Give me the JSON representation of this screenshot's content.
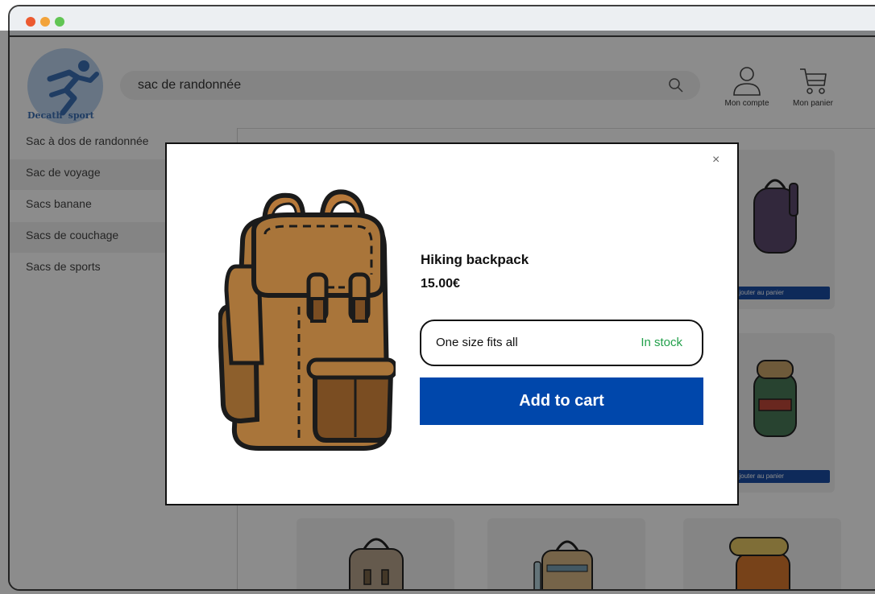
{
  "brand": {
    "name": "Decath' sport"
  },
  "search": {
    "value": "sac de randonnée"
  },
  "header": {
    "account_label": "Mon compte",
    "cart_label": "Mon panier"
  },
  "sidebar": {
    "items": [
      {
        "label": "Sac à dos de randonnée"
      },
      {
        "label": "Sac de voyage"
      },
      {
        "label": "Sacs banane"
      },
      {
        "label": "Sacs de couchage"
      },
      {
        "label": "Sacs de sports"
      }
    ]
  },
  "grid": {
    "add_to_cart_label": "Ajouter au panier"
  },
  "modal": {
    "product_name": "Hiking backpack",
    "price": "15.00€",
    "size": "One size fits all",
    "stock_status": "In stock",
    "add_to_cart": "Add to cart",
    "close_symbol": "×"
  },
  "colors": {
    "accent": "#0047ab",
    "stock": "#22a04b",
    "backpack": "#a9753a"
  }
}
